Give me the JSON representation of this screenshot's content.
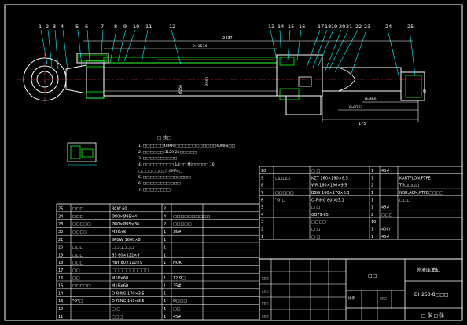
{
  "balloons": [
    "1",
    "2",
    "3",
    "4",
    "5",
    "6",
    "7",
    "8",
    "9",
    "10",
    "11",
    "12",
    "13",
    "14",
    "15",
    "16",
    "17",
    "18",
    "19",
    "20",
    "21",
    "22",
    "23",
    "24",
    "25"
  ],
  "dimensions": {
    "overall": "2437",
    "stroke": "2×1534",
    "bore": "Ø250",
    "rod": "Ø160",
    "pin_top": "Ø-Ø90",
    "pin_bottom": "Ø-Ø207",
    "end": "175",
    "cap": "Ø"
  },
  "notes": {
    "title": "□ 技□",
    "lines": [
      "1. □□□□□□40MPa□□□□□□□□□□□□40MPa□□",
      "2. □□□□□□ 3129-21□□□□□",
      "3. □□□□□□□□□□",
      "4. □□□□□□□□□ 14□□ MI□□□□□ 16",
      "   □□□□□□□□1.6MPa□",
      "5. □□□□□□□□□□□□□□",
      "6. □□□□□□□□□□□",
      "7. □□□□□□□□"
    ]
  },
  "bom_right": [
    {
      "no": "10",
      "code": "",
      "name": "□ □",
      "qty": "1",
      "mat": "45#",
      "note": ""
    },
    {
      "no": "9",
      "code": "□□□□",
      "name": "KZT 160×190×8.5",
      "qty": "1",
      "mat": "",
      "note": "KARTFLON.PTFE"
    },
    {
      "no": "8",
      "code": "",
      "name": "WR 160×190×9.5",
      "qty": "2",
      "mat": "",
      "note": "T5□□□□"
    },
    {
      "no": "7",
      "code": "□□□□□",
      "name": "BSW 160×170×6.3",
      "qty": "1",
      "mat": "",
      "note": "NBR,ACM,PTFE□□□□"
    },
    {
      "no": "6",
      "code": "\"O\"□",
      "name": "O-RING 80(X)3.1",
      "qty": "1",
      "mat": "",
      "note": "□□□"
    },
    {
      "no": "5",
      "code": "",
      "name": "□ □",
      "qty": "1",
      "mat": "45#",
      "note": ""
    },
    {
      "no": "4",
      "code": "",
      "name": "GB79-85",
      "qty": "2",
      "mat": "□□□",
      "note": ""
    },
    {
      "no": "3",
      "code": "",
      "name": "□□□□",
      "qty": "10",
      "mat": "",
      "note": ""
    },
    {
      "no": "2",
      "code": "",
      "name": "□ □",
      "qty": "1",
      "mat": "40Cr",
      "note": ""
    },
    {
      "no": "1",
      "code": "",
      "name": "□ □",
      "qty": "1",
      "mat": "45#",
      "note": ""
    }
  ],
  "bom_right_header": {
    "no": "□",
    "code": "□□",
    "name": "□ □",
    "qty": "□",
    "mat": "□□",
    "note": "□□"
  },
  "bom_left": [
    {
      "no": "25",
      "code": "□□□",
      "name": "RCW 60",
      "qty": "2",
      "mat": "",
      "note": ""
    },
    {
      "no": "24",
      "code": "□□□",
      "name": "Ø80×Ø95×4",
      "qty": "4",
      "mat": "□□□□□□□□□□",
      "note": ""
    },
    {
      "no": "23",
      "code": "□□□□□",
      "name": "Ø80×Ø95×36",
      "qty": "2",
      "mat": "□□□□□",
      "note": ""
    },
    {
      "no": "22",
      "code": "□□□□",
      "name": "M30×8",
      "qty": "1",
      "mat": "35#",
      "note": ""
    },
    {
      "no": "21",
      "code": "",
      "name": "SPGW 1600×8",
      "qty": "1",
      "mat": "",
      "note": ""
    },
    {
      "no": "20",
      "code": "□□□",
      "name": "□□□□□□",
      "qty": "1",
      "mat": "",
      "note": ""
    },
    {
      "no": "19",
      "code": "□□□",
      "name": "BS 60×122×9",
      "qty": "1",
      "mat": "",
      "note": ""
    },
    {
      "no": "18",
      "code": "□□□",
      "name": "HBY 80×110×9",
      "qty": "1",
      "mat": "NOK",
      "note": ""
    },
    {
      "no": "17",
      "code": "□□",
      "name": "□□□□□□□□□□",
      "qty": "",
      "mat": "",
      "note": ""
    },
    {
      "no": "16",
      "code": "□□",
      "name": "M16×60",
      "qty": "1",
      "mat": "12.9□",
      "note": ""
    },
    {
      "no": "15",
      "code": "□□□□□",
      "name": "M16×60",
      "qty": "1",
      "mat": "35#",
      "note": ""
    },
    {
      "no": "14",
      "code": "",
      "name": "O-RING 170×3.5",
      "qty": "1",
      "mat": "",
      "note": ""
    },
    {
      "no": "13",
      "code": "\"O\"□",
      "name": "O-RING 160×3.5",
      "qty": "1",
      "mat": "O□□□",
      "note": ""
    },
    {
      "no": "12",
      "code": "",
      "name": "□ □",
      "qty": "1",
      "mat": "□□",
      "note": ""
    },
    {
      "no": "11",
      "code": "",
      "name": "□□□",
      "qty": "1",
      "mat": "45#",
      "note": ""
    }
  ],
  "title_block": {
    "drawing_title": "□□",
    "product": "外液压油缸",
    "drawing_no": "DH250-8□□□",
    "sheet": "□ 张  □ 张",
    "scale_label": "比例",
    "weight_label": "□□",
    "designer": "□□",
    "checker": "□□",
    "approver": "□□",
    "date": "□□"
  },
  "colors": {
    "background": "#000000",
    "outline": "#ffffff",
    "leader": "#00ffff",
    "accent": "#ffff00",
    "hatch": "#00ff00",
    "dim": "#ff4040"
  }
}
